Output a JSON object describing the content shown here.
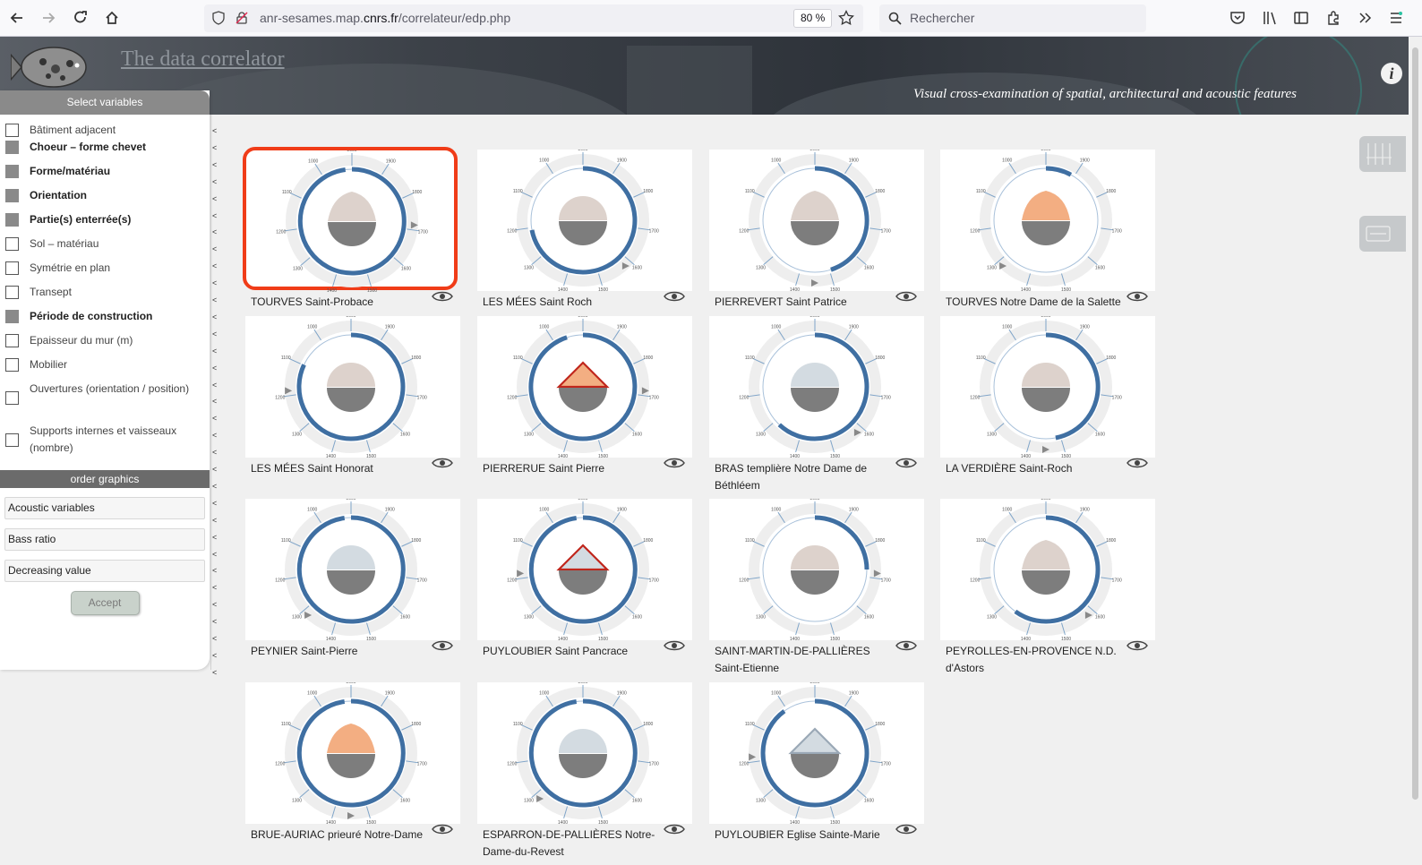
{
  "browser": {
    "url_prefix": "anr-sesames.map.",
    "url_domain": "cnrs.fr",
    "url_path": "/correlateur/edp.php",
    "zoom": "80 %",
    "search_placeholder": "Rechercher"
  },
  "header": {
    "title": "The data correlator",
    "subtitle": "Visual cross-examination of spatial, architectural and acoustic features",
    "info_label": "i"
  },
  "left_panel": {
    "title": "Select variables",
    "variables": [
      {
        "label": "Bâtiment adjacent",
        "selected": false
      },
      {
        "label": "Choeur – forme chevet",
        "selected": true
      },
      {
        "label": "Forme/matériau",
        "selected": true
      },
      {
        "label": "Orientation",
        "selected": true
      },
      {
        "label": "Partie(s) enterrée(s)",
        "selected": true
      },
      {
        "label": "Sol – matériau",
        "selected": false
      },
      {
        "label": "Symétrie en plan",
        "selected": false
      },
      {
        "label": "Transept",
        "selected": false
      },
      {
        "label": "Période de construction",
        "selected": true
      },
      {
        "label": "Epaisseur du mur (m)",
        "selected": false
      },
      {
        "label": "Mobilier",
        "selected": false
      },
      {
        "label": "Ouvertures (orientation / position)",
        "selected": false
      },
      {
        "label": "Supports internes et vaisseaux (nombre)",
        "selected": false
      }
    ],
    "order_title": "order graphics",
    "order_fields": [
      "Acoustic variables",
      "Bass ratio",
      "Decreasing value"
    ],
    "accept_label": "Accept"
  },
  "ticks": [
    "2000",
    "1900",
    "1800",
    "1700",
    "1600",
    "1500",
    "1400",
    "1300",
    "1200",
    "1100",
    "1000"
  ],
  "cards": [
    {
      "label": "TOURVES Saint-Probace",
      "shape": "dome",
      "fill": "#ddd2cc",
      "arc": [
        0.0,
        0.98
      ],
      "highlight": true
    },
    {
      "label": "LES MÉES Saint Roch",
      "shape": "round",
      "fill": "#ddd2cc",
      "arc": [
        0.0,
        0.72
      ]
    },
    {
      "label": "PIERREVERT Saint Patrice",
      "shape": "dome",
      "fill": "#ddd2cc",
      "arc": [
        0.0,
        0.45
      ]
    },
    {
      "label": "TOURVES Notre Dame de la Salette",
      "shape": "dome",
      "fill": "#f3ae82",
      "arc": [
        0.0,
        0.08
      ]
    },
    {
      "label": "LES MÉES Saint Honorat",
      "shape": "round",
      "fill": "#ddd2cc",
      "arc": [
        0.0,
        0.82
      ]
    },
    {
      "label": "PIERRERUE Saint Pierre",
      "shape": "triangle",
      "fill": "#f3ae82",
      "arc": [
        0.0,
        0.95
      ]
    },
    {
      "label": "BRAS templière Notre Dame de Béthléem",
      "shape": "round",
      "fill": "#d3dbe1",
      "arc": [
        0.0,
        0.62
      ]
    },
    {
      "label": "LA VERDIÈRE Saint-Roch",
      "shape": "round",
      "fill": "#ddd2cc",
      "arc": [
        0.0,
        0.47
      ]
    },
    {
      "label": "PEYNIER Saint-Pierre",
      "shape": "round",
      "fill": "#d3dbe1",
      "arc": [
        0.0,
        0.98
      ]
    },
    {
      "label": "PUYLOUBIER Saint Pancrace",
      "shape": "triangle",
      "fill": "#d3dbe1",
      "arc": [
        0.0,
        0.98
      ]
    },
    {
      "label": "SAINT-MARTIN-DE-PALLIÈRES Saint-Etienne",
      "shape": "round",
      "fill": "#ddd2cc",
      "arc": [
        0.0,
        0.25
      ]
    },
    {
      "label": "PEYROLLES-EN-PROVENCE N.D. d'Astors",
      "shape": "dome",
      "fill": "#ddd2cc",
      "arc": [
        0.0,
        0.6
      ]
    },
    {
      "label": "BRUE-AURIAC prieuré Notre-Dame",
      "shape": "dome",
      "fill": "#f3ae82",
      "arc": [
        0.0,
        0.98
      ]
    },
    {
      "label": "ESPARRON-DE-PALLIÈRES Notre-Dame-du-Revest",
      "shape": "round",
      "fill": "#d3dbe1",
      "arc": [
        0.0,
        0.98
      ]
    },
    {
      "label": "PUYLOUBIER Eglise Sainte-Marie",
      "shape": "triangle",
      "fill": "#d3dbe1",
      "arc": [
        0.0,
        0.9
      ]
    }
  ]
}
